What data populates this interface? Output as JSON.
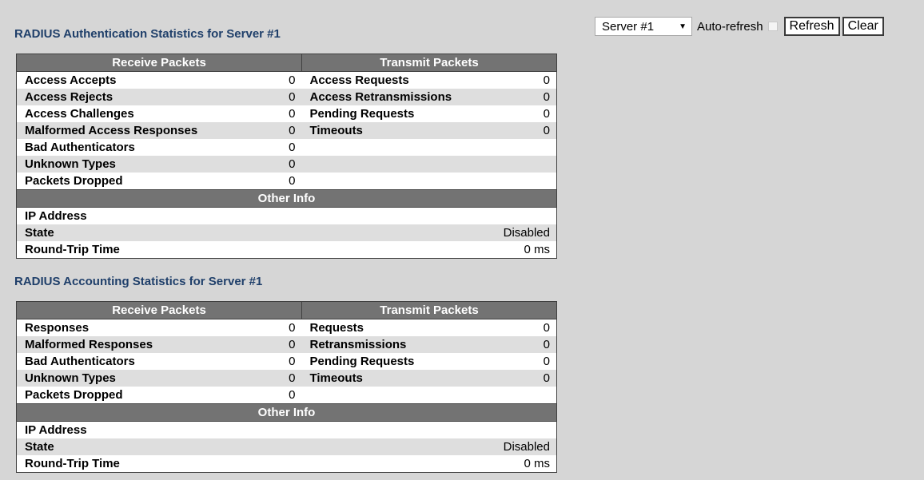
{
  "controls": {
    "server_select": "Server #1",
    "auto_refresh_label": "Auto-refresh",
    "refresh_label": "Refresh",
    "clear_label": "Clear"
  },
  "auth": {
    "title": "RADIUS Authentication Statistics for Server #1",
    "headers": {
      "receive": "Receive Packets",
      "transmit": "Transmit Packets",
      "other": "Other Info"
    },
    "rows": [
      {
        "rx_label": "Access Accepts",
        "rx_value": "0",
        "tx_label": "Access Requests",
        "tx_value": "0"
      },
      {
        "rx_label": "Access Rejects",
        "rx_value": "0",
        "tx_label": "Access Retransmissions",
        "tx_value": "0"
      },
      {
        "rx_label": "Access Challenges",
        "rx_value": "0",
        "tx_label": "Pending Requests",
        "tx_value": "0"
      },
      {
        "rx_label": "Malformed Access Responses",
        "rx_value": "0",
        "tx_label": "Timeouts",
        "tx_value": "0"
      },
      {
        "rx_label": "Bad Authenticators",
        "rx_value": "0",
        "tx_label": "",
        "tx_value": ""
      },
      {
        "rx_label": "Unknown Types",
        "rx_value": "0",
        "tx_label": "",
        "tx_value": ""
      },
      {
        "rx_label": "Packets Dropped",
        "rx_value": "0",
        "tx_label": "",
        "tx_value": ""
      }
    ],
    "other": [
      {
        "label": "IP Address",
        "value": ""
      },
      {
        "label": "State",
        "value": "Disabled"
      },
      {
        "label": "Round-Trip Time",
        "value": "0 ms"
      }
    ]
  },
  "acct": {
    "title": "RADIUS Accounting Statistics for Server #1",
    "headers": {
      "receive": "Receive Packets",
      "transmit": "Transmit Packets",
      "other": "Other Info"
    },
    "rows": [
      {
        "rx_label": "Responses",
        "rx_value": "0",
        "tx_label": "Requests",
        "tx_value": "0"
      },
      {
        "rx_label": "Malformed Responses",
        "rx_value": "0",
        "tx_label": "Retransmissions",
        "tx_value": "0"
      },
      {
        "rx_label": "Bad Authenticators",
        "rx_value": "0",
        "tx_label": "Pending Requests",
        "tx_value": "0"
      },
      {
        "rx_label": "Unknown Types",
        "rx_value": "0",
        "tx_label": "Timeouts",
        "tx_value": "0"
      },
      {
        "rx_label": "Packets Dropped",
        "rx_value": "0",
        "tx_label": "",
        "tx_value": ""
      }
    ],
    "other": [
      {
        "label": "IP Address",
        "value": ""
      },
      {
        "label": "State",
        "value": "Disabled"
      },
      {
        "label": "Round-Trip Time",
        "value": "0 ms"
      }
    ]
  }
}
